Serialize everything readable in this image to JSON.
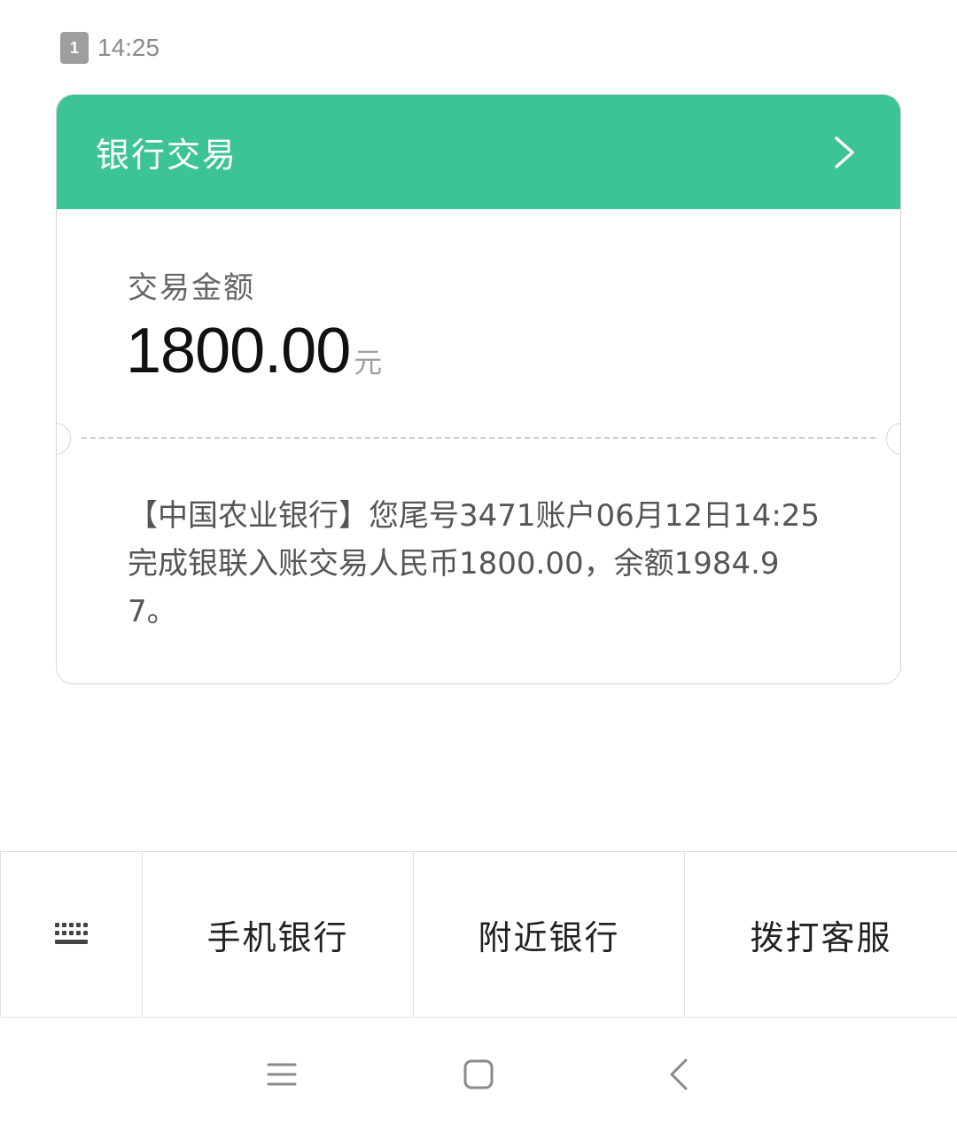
{
  "status": {
    "sim_label": "1",
    "time": "14:25"
  },
  "card": {
    "title": "银行交易",
    "amount_label": "交易金额",
    "amount_value": "1800.00",
    "amount_unit": "元",
    "message": "【中国农业银行】您尾号3471账户06月12日14:25完成银联入账交易人民币1800.00，余额1984.97。"
  },
  "actions": {
    "mobile_bank": "手机银行",
    "nearby_bank": "附近银行",
    "call_service": "拨打客服"
  },
  "icons": {
    "keyboard": "keyboard-icon",
    "chevron": "chevron-right-icon",
    "menu": "menu-icon",
    "home": "home-icon",
    "back": "back-icon"
  },
  "colors": {
    "accent": "#3dc494"
  }
}
